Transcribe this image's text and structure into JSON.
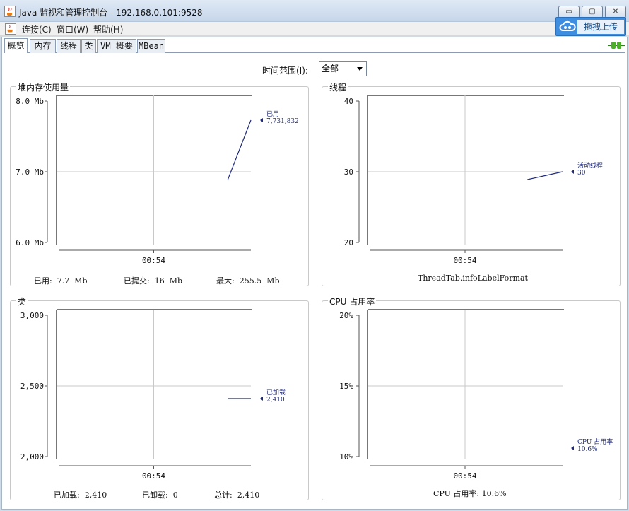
{
  "window": {
    "title": "Java 监视和管理控制台 - 192.168.0.101:9528"
  },
  "window_buttons": {
    "minimize": "▭",
    "maximize": "▢",
    "close": "✕"
  },
  "menu": [
    "连接(C)",
    "窗口(W)",
    "帮助(H)"
  ],
  "upload": {
    "label": "拖拽上传"
  },
  "tabs": [
    "概览",
    "内存",
    "线程",
    "类",
    "VM 概要",
    "MBean"
  ],
  "active_tab": 0,
  "time_range": {
    "label": "时间范围(I):",
    "value": "全部"
  },
  "panels": [
    {
      "title": "堆内存使用量",
      "yticks": [
        "8.0 Mb",
        "7.0 Mb",
        "6.0 Mb"
      ],
      "xtick": "00:54",
      "ylim": [
        6.0,
        8.0
      ],
      "series_label": [
        "已用",
        "7,731,832"
      ],
      "points": [
        [
          0.88,
          6.88
        ],
        [
          1.0,
          7.73
        ]
      ],
      "marker_value": 7.73,
      "summary": [
        "已用:  7.7  Mb",
        "已提交:  16  Mb",
        "最大:  255.5  Mb"
      ]
    },
    {
      "title": "线程",
      "yticks": [
        "40",
        "30",
        "20"
      ],
      "xtick": "00:54",
      "ylim": [
        20,
        40
      ],
      "series_label": [
        "活动线程",
        "30"
      ],
      "points": [
        [
          0.82,
          28.9
        ],
        [
          1.0,
          30
        ]
      ],
      "marker_value": 30,
      "summary": [
        "ThreadTab.infoLabelFormat"
      ]
    },
    {
      "title": "类",
      "yticks": [
        "3,000",
        "2,500",
        "2,000"
      ],
      "xtick": "00:54",
      "ylim": [
        2000,
        3000
      ],
      "series_label": [
        "已加载",
        "2,410"
      ],
      "points": [
        [
          0.88,
          2410
        ],
        [
          1.0,
          2410
        ]
      ],
      "marker_value": 2410,
      "summary": [
        "已加载:  2,410",
        "已卸载:  0",
        "总计:  2,410"
      ]
    },
    {
      "title": "CPU 占用率",
      "yticks": [
        "20%",
        "15%",
        "10%"
      ],
      "xtick": "00:54",
      "ylim": [
        10,
        20
      ],
      "series_label": [
        "CPU 占用率",
        "10.6%"
      ],
      "points": [],
      "marker_value": 10.6,
      "summary": [
        "CPU 占用率: 10.6%"
      ]
    }
  ],
  "colors": {
    "series": "#1f2a7a",
    "grid": "#c8c8c8",
    "axis": "#555555"
  }
}
